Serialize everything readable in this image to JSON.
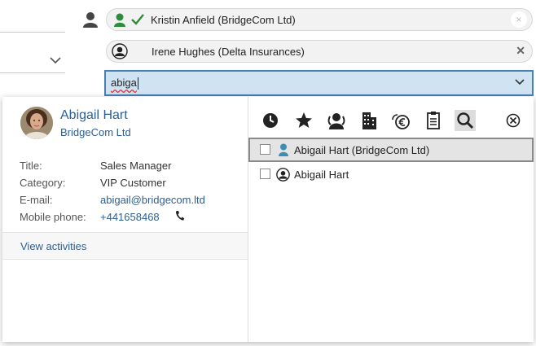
{
  "chips": [
    {
      "label": "Kristin Anfield (BridgeCom Ltd)",
      "remove": "×"
    },
    {
      "label": "Irene Hughes (Delta Insurances)",
      "remove": "✕"
    }
  ],
  "search": {
    "value": "abiga"
  },
  "contact": {
    "name": "Abigail Hart",
    "company": "BridgeCom Ltd",
    "fields": [
      {
        "label": "Title:",
        "value": "Sales Manager"
      },
      {
        "label": "Category:",
        "value": "VIP Customer"
      },
      {
        "label": "E-mail:",
        "value": "abigail@bridgecom.ltd"
      },
      {
        "label": "Mobile phone:",
        "value": "+441658468"
      }
    ],
    "activities_link": "View activities"
  },
  "toolbar": {
    "icons": [
      "clock-icon",
      "star-icon",
      "contacts-icon",
      "building-icon",
      "euro-coin-icon",
      "clipboard-icon",
      "search-icon",
      "close-circle-icon"
    ],
    "selected": "search-icon"
  },
  "results": [
    {
      "label": "Abigail Hart (BridgeCom Ltd)",
      "icon": "contact-person-icon",
      "highlighted": true
    },
    {
      "label": "Abigail Hart",
      "icon": "user-circle-icon",
      "highlighted": false
    }
  ],
  "colors": {
    "accent": "#2c5f94",
    "green": "#2e8b3a",
    "search_bg": "#cfe3f3",
    "search_border": "#4a7fb5"
  }
}
